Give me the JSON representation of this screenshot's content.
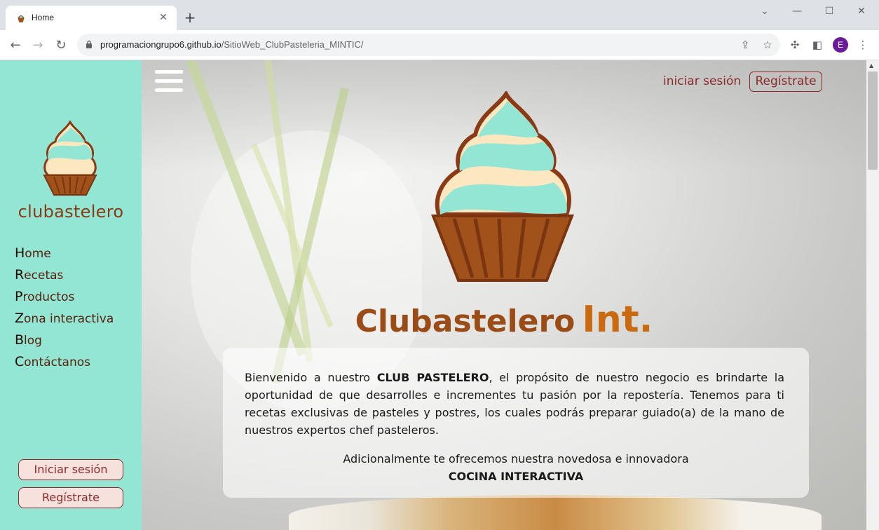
{
  "browser": {
    "tab_title": "Home",
    "tab_close": "✕",
    "new_tab": "+",
    "url_host": "programaciongrupo6.github.io",
    "url_path": "/SitioWeb_ClubPasteleria_MINTIC/",
    "profile_initial": "E"
  },
  "sidebar": {
    "brand": "clubastelero",
    "menu": [
      {
        "first": "H",
        "rest": "ome"
      },
      {
        "first": "R",
        "rest": "ecetas"
      },
      {
        "first": "P",
        "rest": "roductos"
      },
      {
        "first": "Z",
        "rest": "ona interactiva"
      },
      {
        "first": "B",
        "rest": "log"
      },
      {
        "first": "C",
        "rest": "ontáctanos"
      }
    ],
    "login_button": "Iniciar sesión",
    "register_button": "Regístrate"
  },
  "header": {
    "login_link": "iniciar sesión",
    "register_button": "Regístrate"
  },
  "hero": {
    "title_main": "Clubastelero",
    "title_suffix": "Int.",
    "intro_pre": "Bienvenido a nuestro ",
    "intro_bold": "CLUB PASTELERO",
    "intro_post": ", el propósito de nuestro negocio es brindarte la oportunidad de que desarrolles e incrementes tu pasión por la repostería. Tenemos para ti recetas exclusivas de pasteles y postres, los cuales podrás preparar guiado(a) de la mano de nuestros expertos chef pasteleros.",
    "extra_line": "Adicionalmente te ofrecemos nuestra novedosa e innovadora",
    "extra_bold": "COCINA INTERACTIVA"
  },
  "colors": {
    "sidebar_bg": "#93e6d4",
    "accent": "#8a2a2a",
    "brand_brown": "#9a4b16",
    "brand_orange": "#c96a10"
  }
}
